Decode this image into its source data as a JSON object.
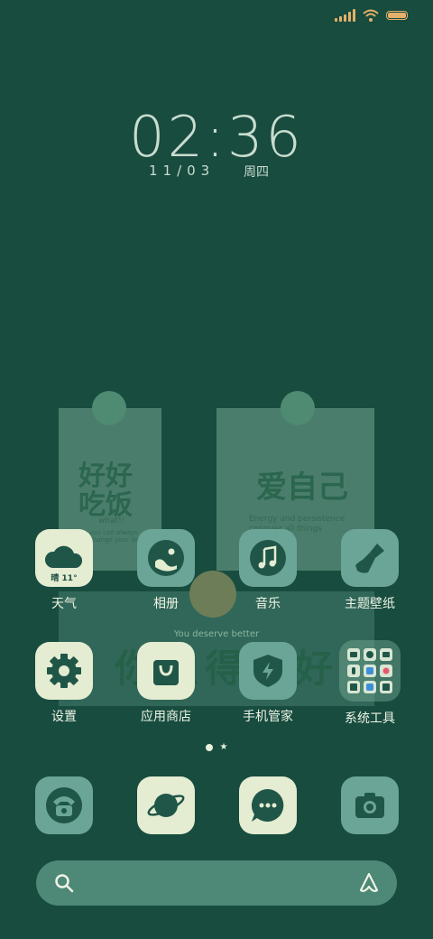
{
  "clock": {
    "time": "02:36",
    "date": "11/03",
    "weekday": "周四"
  },
  "widgets": {
    "note_left": {
      "title_line1": "好好",
      "title_line2": "吃饭",
      "subtitle": "what!!",
      "fine_print": "you can always\nchange your day"
    },
    "note_right": {
      "title": "爱自己",
      "fine_print": "Energy and persistence\nconquer all things"
    },
    "banner": {
      "subtitle": "You deserve better",
      "title": "你值得更好"
    }
  },
  "apps_row1": [
    {
      "label": "天气",
      "icon": "weather-icon",
      "temp": "晴 11°"
    },
    {
      "label": "相册",
      "icon": "gallery-icon"
    },
    {
      "label": "音乐",
      "icon": "music-icon"
    },
    {
      "label": "主题壁纸",
      "icon": "brush-icon"
    }
  ],
  "apps_row2": [
    {
      "label": "设置",
      "icon": "gear-icon"
    },
    {
      "label": "应用商店",
      "icon": "shopping-bag-icon"
    },
    {
      "label": "手机管家",
      "icon": "shield-icon"
    },
    {
      "label": "系统工具",
      "icon": "folder-icon"
    }
  ],
  "dock": [
    {
      "icon": "phone-icon"
    },
    {
      "icon": "browser-planet-icon"
    },
    {
      "icon": "message-icon"
    },
    {
      "icon": "camera-icon"
    }
  ],
  "colors": {
    "background": "#174c3f",
    "tile_light": "#e4ecd2",
    "tile_teal": "#6aa597",
    "accent_status": "#e5b06a"
  },
  "search": {
    "left_icon": "search-icon",
    "right_icon": "assistant-icon"
  }
}
